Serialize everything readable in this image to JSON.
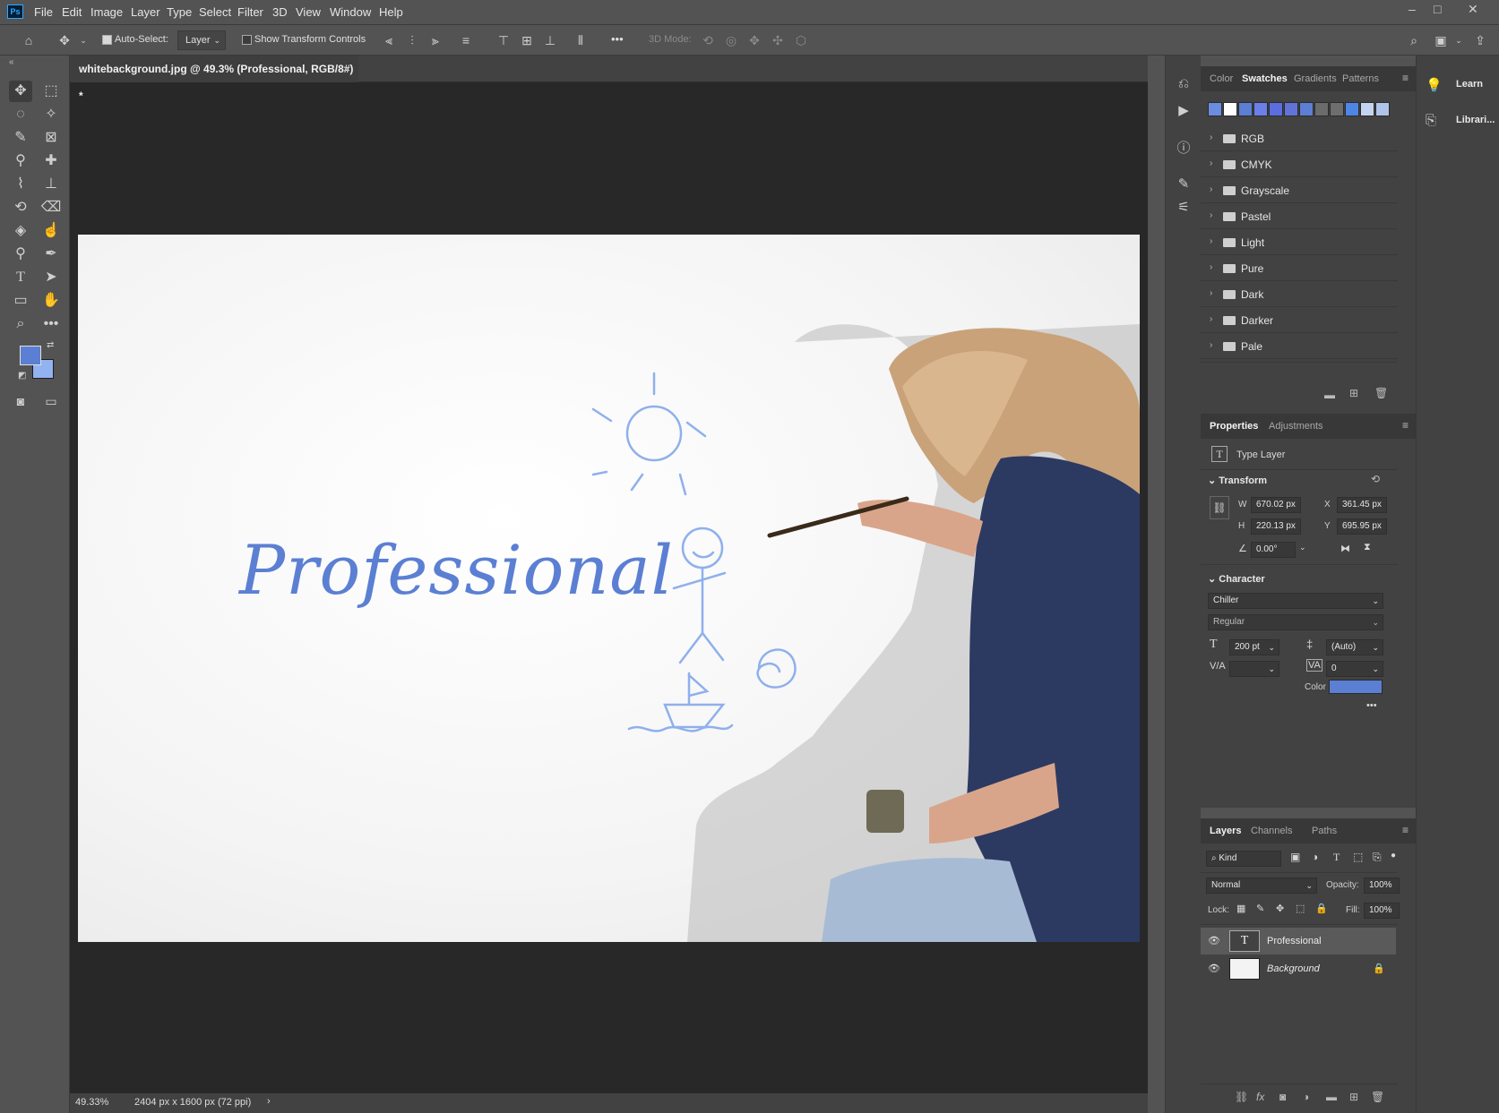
{
  "app": {
    "logo": "Ps"
  },
  "menubar": {
    "items": [
      "File",
      "Edit",
      "Image",
      "Layer",
      "Type",
      "Select",
      "Filter",
      "3D",
      "View",
      "Window",
      "Help"
    ]
  },
  "options": {
    "auto_select_label": "Auto-Select:",
    "auto_select_value": "Layer",
    "show_transform_label": "Show Transform Controls",
    "mode_3d_label": "3D Mode:",
    "more_glyph": "•••"
  },
  "document": {
    "tab_title": "whitebackground.jpg @ 49.3% (Professional, RGB/8#) *",
    "tab_close": "×",
    "canvas_text": "Professional",
    "canvas_text_color": "#5b7fd3"
  },
  "status": {
    "zoom": "49.33%",
    "doc_size": "2404 px x 1600 px (72 ppi)",
    "arrow": "›"
  },
  "colors": {
    "foreground": "#5b7fd3",
    "background": "#92b3f0"
  },
  "swatches_panel": {
    "tabs": [
      "Color",
      "Swatches",
      "Gradients",
      "Patterns"
    ],
    "active_tab": "Swatches",
    "swatch_colors": [
      "#6a8de0",
      "#ffffff",
      "#5b7fd3",
      "#6b7fe8",
      "#5a6ee0",
      "#6173d8",
      "#5c7fd3",
      "#6b6b6b",
      "#6e6e6e",
      "#4f86e6",
      "#c4d4f0",
      "#b0c4e8"
    ],
    "groups": [
      "RGB",
      "CMYK",
      "Grayscale",
      "Pastel",
      "Light",
      "Pure",
      "Dark",
      "Darker",
      "Pale"
    ]
  },
  "properties_panel": {
    "tabs": [
      "Properties",
      "Adjustments"
    ],
    "active_tab": "Properties",
    "layer_type": "Type Layer",
    "transform_label": "Transform",
    "w_label": "W",
    "w_value": "670.02 px",
    "h_label": "H",
    "h_value": "220.13 px",
    "x_label": "X",
    "x_value": "361.45 px",
    "y_label": "Y",
    "y_value": "695.95 px",
    "angle_value": "0.00°",
    "character_label": "Character",
    "font_family": "Chiller",
    "font_style": "Regular",
    "font_size": "200 pt",
    "leading": "(Auto)",
    "tracking": "0",
    "color_label": "Color",
    "text_color": "#5b7fd3",
    "more": "•••"
  },
  "layers_panel": {
    "tabs": [
      "Layers",
      "Channels",
      "Paths"
    ],
    "active_tab": "Layers",
    "filter_kind": "Kind",
    "blend_mode": "Normal",
    "opacity_label": "Opacity:",
    "opacity": "100%",
    "lock_label": "Lock:",
    "fill_label": "Fill:",
    "fill": "100%",
    "layers": [
      {
        "name": "Professional",
        "type": "text",
        "selected": true
      },
      {
        "name": "Background",
        "type": "image",
        "locked": true
      }
    ]
  },
  "far_right": {
    "items": [
      "Learn",
      "Librari..."
    ]
  }
}
